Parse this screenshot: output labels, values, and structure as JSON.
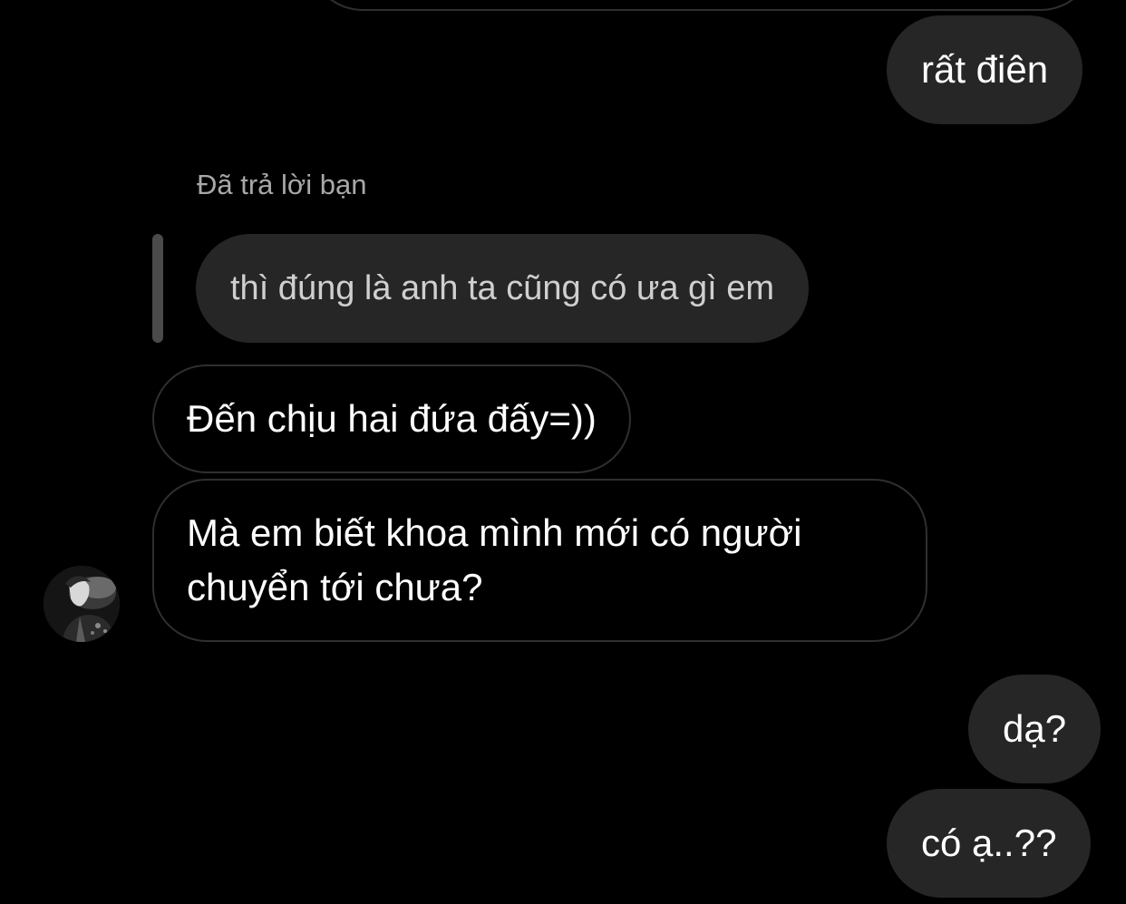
{
  "messages": {
    "sent_1": "rất điên",
    "reply_label": "Đã trả lời bạn",
    "quoted": "thì đúng là anh ta cũng có ưa gì em",
    "received_1": "Đến chịu hai đứa đấy=))",
    "received_2": "Mà em biết khoa mình mới có người chuyển tới chưa?",
    "sent_2": "dạ?",
    "sent_3": "có ạ..??"
  },
  "colors": {
    "background": "#000000",
    "sent_bubble": "#262626",
    "received_border": "#2f2f2f",
    "muted_text": "#a8a8a8"
  }
}
